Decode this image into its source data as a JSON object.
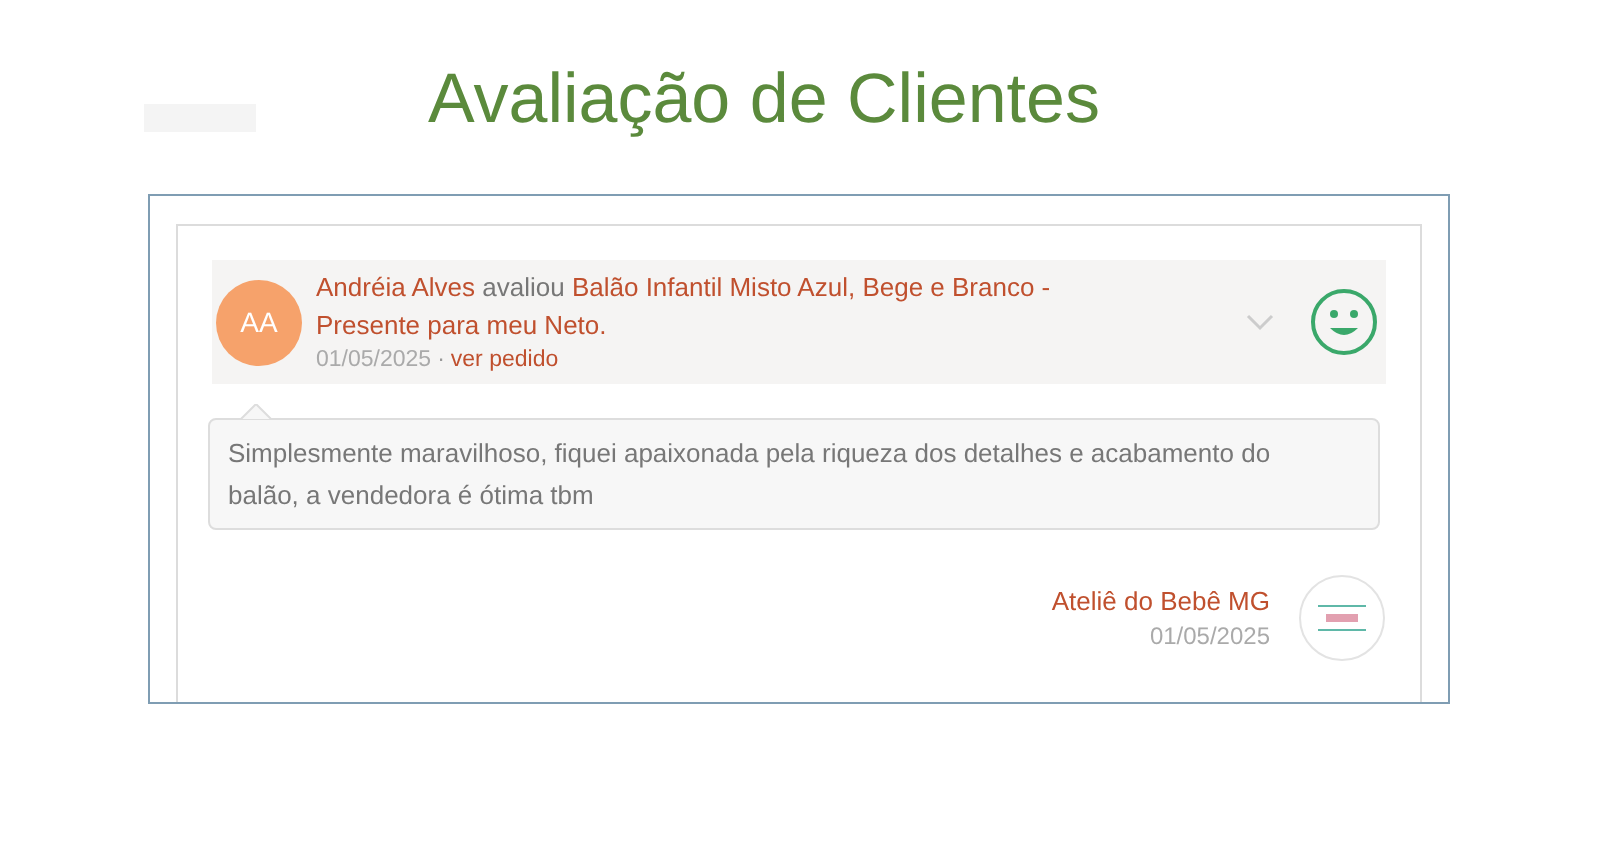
{
  "title": "Avaliação de Clientes",
  "review": {
    "avatar": "AA",
    "author": "Andréia Alves",
    "verb": "avaliou",
    "product": "Balão Infantil Misto Azul, Bege e Branco - Presente para meu Neto.",
    "date": "01/05/2025",
    "separator": "·",
    "order_link": "ver pedido",
    "expanded": false,
    "comment": "Simplesmente maravilhoso, fiquei apaixonada pela riqueza dos detalhes e acabamento do balão, a vendedora é ótima tbm"
  },
  "reply": {
    "seller": "Ateliê do Bebê MG",
    "date": "01/05/2025"
  }
}
